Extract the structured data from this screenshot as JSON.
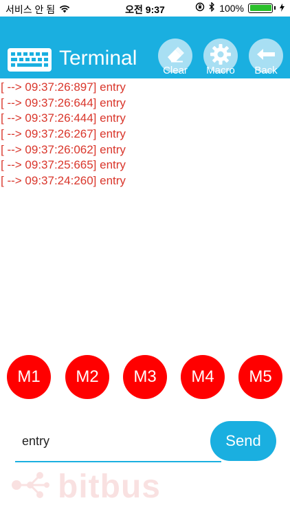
{
  "status_bar": {
    "carrier": "서비스 안 됨",
    "time": "오전 9:37",
    "battery_pct": "100%",
    "battery_level": 1.0,
    "battery_color": "#2bc02b"
  },
  "header": {
    "title": "Terminal",
    "bg_color": "#1aafe0",
    "buttons": [
      {
        "label": "Clear",
        "icon": "eraser-icon"
      },
      {
        "label": "Macro",
        "icon": "gear-icon"
      },
      {
        "label": "Back",
        "icon": "arrow-left-icon"
      }
    ]
  },
  "log": {
    "color": "#d9362b",
    "lines": [
      "[ --> 09:37:26:897] entry",
      "[ --> 09:37:26:644] entry",
      "[ --> 09:37:26:444] entry",
      "[ --> 09:37:26:267] entry",
      "[ --> 09:37:26:062] entry",
      "[ --> 09:37:25:665] entry",
      "[ --> 09:37:24:260] entry"
    ]
  },
  "macros": [
    {
      "label": "M1"
    },
    {
      "label": "M2"
    },
    {
      "label": "M3"
    },
    {
      "label": "M4"
    },
    {
      "label": "M5"
    }
  ],
  "macro_color": "#ff0000",
  "input": {
    "value": "entry",
    "placeholder": ""
  },
  "send_label": "Send",
  "logo": {
    "text": "bitbus"
  }
}
